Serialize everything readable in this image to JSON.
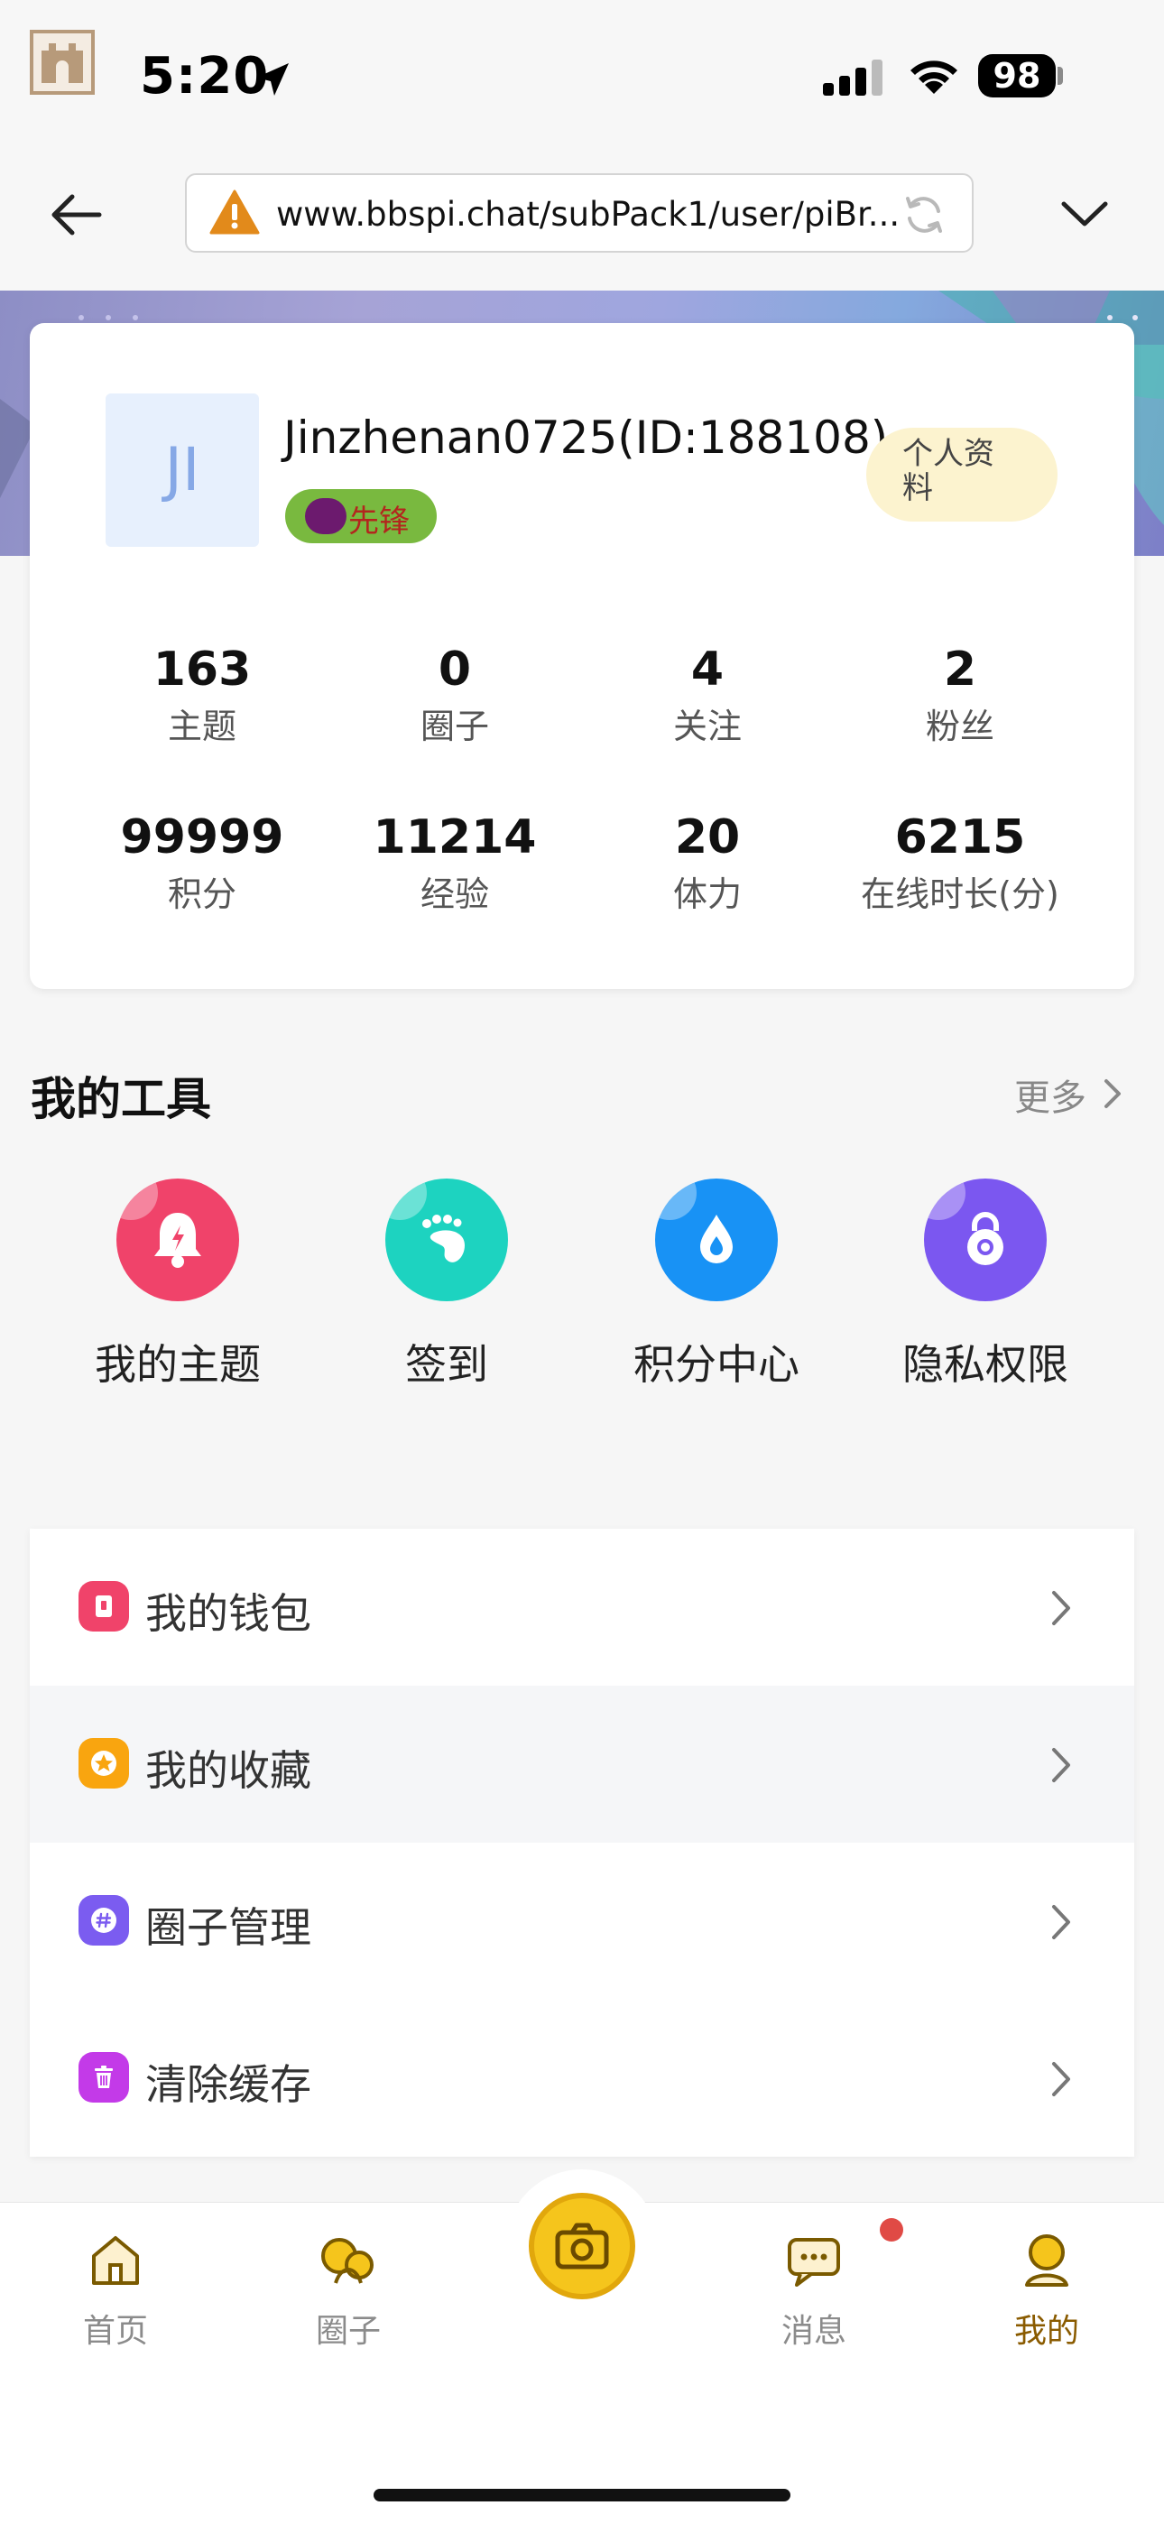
{
  "status_bar": {
    "time": "5:20",
    "battery": "98"
  },
  "browser": {
    "url": "www.bbspi.chat/subPack1/user/piBr..."
  },
  "profile": {
    "avatar_initials": "JI",
    "username": "Jinzhenan0725(ID:188108)",
    "badge_label": "先锋",
    "profile_button": "个人资料",
    "stats": [
      {
        "value": "163",
        "label": "主题"
      },
      {
        "value": "0",
        "label": "圈子"
      },
      {
        "value": "4",
        "label": "关注"
      },
      {
        "value": "2",
        "label": "粉丝"
      },
      {
        "value": "99999",
        "label": "积分"
      },
      {
        "value": "11214",
        "label": "经验"
      },
      {
        "value": "20",
        "label": "体力"
      },
      {
        "value": "6215",
        "label": "在线时长(分)"
      }
    ]
  },
  "tools": {
    "title": "我的工具",
    "more": "更多",
    "items": [
      {
        "label": "我的主题",
        "icon": "bell-icon",
        "color": "#f0436a"
      },
      {
        "label": "签到",
        "icon": "footprint-icon",
        "color": "#1dd3c0"
      },
      {
        "label": "积分中心",
        "icon": "drop-icon",
        "color": "#1892f5"
      },
      {
        "label": "隐私权限",
        "icon": "lock-icon",
        "color": "#7b57f0"
      }
    ]
  },
  "menu": [
    {
      "label": "我的钱包",
      "icon": "wallet-icon",
      "color": "#f0436a"
    },
    {
      "label": "我的收藏",
      "icon": "star-icon",
      "color": "#f9a50f"
    },
    {
      "label": "圈子管理",
      "icon": "hashtag-icon",
      "color": "#7b5cf0"
    },
    {
      "label": "清除缓存",
      "icon": "trash-icon",
      "color": "#c33ae8"
    }
  ],
  "tabs": [
    {
      "label": "首页",
      "icon": "home-icon"
    },
    {
      "label": "圈子",
      "icon": "circles-icon"
    },
    {
      "label": "消息",
      "icon": "message-icon"
    },
    {
      "label": "我的",
      "icon": "user-icon",
      "active": true
    }
  ]
}
